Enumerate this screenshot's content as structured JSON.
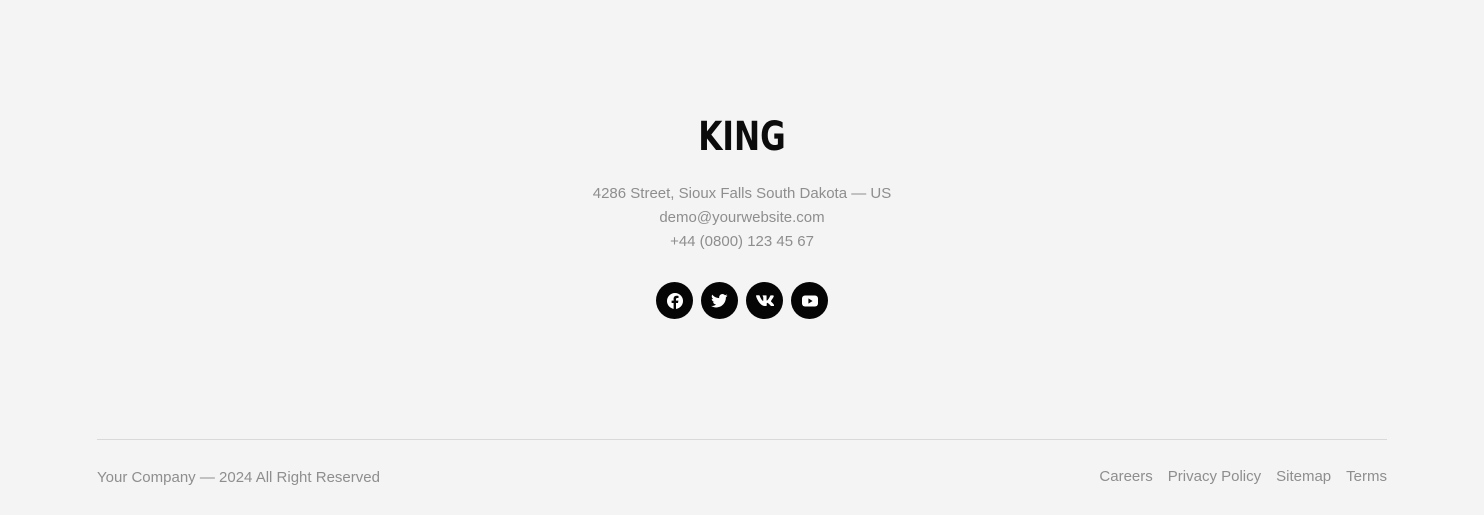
{
  "brand": {
    "name": "KING"
  },
  "contact": {
    "address": "4286 Street, Sioux Falls South Dakota — US",
    "email": "demo@yourwebsite.com",
    "phone": "+44 (0800) 123 45 67"
  },
  "social": [
    {
      "icon": "facebook-icon"
    },
    {
      "icon": "twitter-icon"
    },
    {
      "icon": "vk-icon"
    },
    {
      "icon": "youtube-icon"
    }
  ],
  "footer": {
    "copyright": "Your Company — 2024 All Right Reserved",
    "links": [
      "Careers",
      "Privacy Policy",
      "Sitemap",
      "Terms"
    ]
  },
  "colors": {
    "background": "#f4f4f4",
    "brand_text": "#0b0b0b",
    "muted_text": "#8e8e8e",
    "social_button": "#050505",
    "divider": "#d9d9d9"
  }
}
